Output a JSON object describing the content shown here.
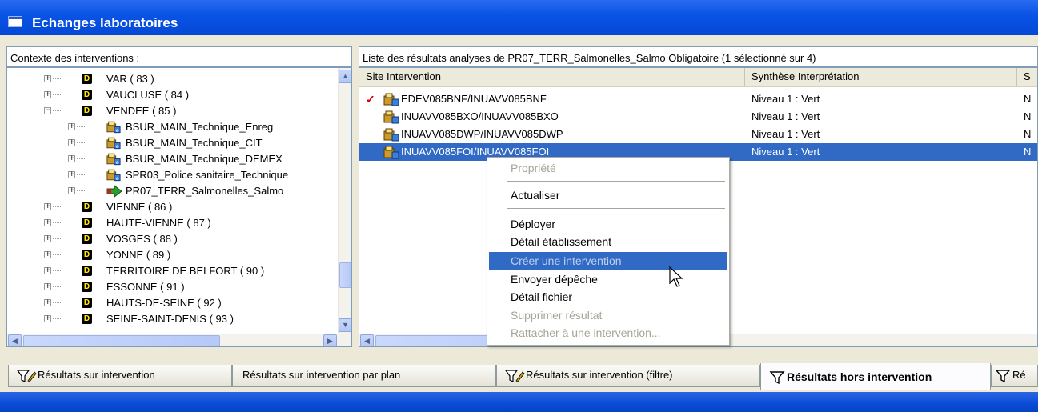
{
  "window": {
    "title": "Echanges laboratoires"
  },
  "left_pane": {
    "header": "Contexte des interventions :",
    "tree": [
      {
        "label": "VAR ( 83 )",
        "type": "dept",
        "expander": "+"
      },
      {
        "label": "VAUCLUSE ( 84 )",
        "type": "dept",
        "expander": "+"
      },
      {
        "label": "VENDEE ( 85 )",
        "type": "dept",
        "expander": "−"
      },
      {
        "label": "BSUR_MAIN_Technique_Enreg",
        "type": "folder",
        "expander": "+"
      },
      {
        "label": "BSUR_MAIN_Technique_CIT",
        "type": "folder",
        "expander": "+"
      },
      {
        "label": "BSUR_MAIN_Technique_DEMEX",
        "type": "folder",
        "expander": "+"
      },
      {
        "label": "SPR03_Police sanitaire_Technique",
        "type": "folder",
        "expander": "+"
      },
      {
        "label": "PR07_TERR_Salmonelles_Salmo",
        "type": "arrow",
        "expander": "+"
      },
      {
        "label": "VIENNE ( 86 )",
        "type": "dept",
        "expander": "+"
      },
      {
        "label": "HAUTE-VIENNE ( 87 )",
        "type": "dept",
        "expander": "+"
      },
      {
        "label": "VOSGES ( 88 )",
        "type": "dept",
        "expander": "+"
      },
      {
        "label": "YONNE ( 89 )",
        "type": "dept",
        "expander": "+"
      },
      {
        "label": "TERRITOIRE DE BELFORT ( 90 )",
        "type": "dept",
        "expander": "+"
      },
      {
        "label": "ESSONNE ( 91 )",
        "type": "dept",
        "expander": "+"
      },
      {
        "label": "HAUTS-DE-SEINE ( 92 )",
        "type": "dept",
        "expander": "+"
      },
      {
        "label": "SEINE-SAINT-DENIS ( 93 )",
        "type": "dept",
        "expander": "+"
      }
    ]
  },
  "right_pane": {
    "header": "Liste des résultats analyses de PR07_TERR_Salmonelles_Salmo Obligatoire (1 sélectionné sur 4)",
    "columns": [
      "Site Intervention",
      "Synthèse Interprétation",
      "S"
    ],
    "rows": [
      {
        "site": "EDEV085BNF/INUAVV085BNF",
        "synthese": "Niveau 1 : Vert",
        "col3": "N",
        "checked": "✓",
        "selected": false
      },
      {
        "site": "INUAVV085BXO/INUAVV085BXO",
        "synthese": "Niveau 1 : Vert",
        "col3": "N",
        "checked": "",
        "selected": false
      },
      {
        "site": "INUAVV085DWP/INUAVV085DWP",
        "synthese": "Niveau 1 : Vert",
        "col3": "N",
        "checked": "",
        "selected": false
      },
      {
        "site": "INUAVV085FOI/INUAVV085FOI",
        "synthese": "Niveau 1 : Vert",
        "col3": "N",
        "checked": "",
        "selected": true
      }
    ]
  },
  "context_menu": {
    "items": [
      {
        "label": "Propriété",
        "state": "disabled"
      },
      {
        "label": "Actualiser",
        "state": "enabled"
      },
      {
        "label": "Déployer",
        "state": "enabled"
      },
      {
        "label": "Détail établissement",
        "state": "enabled"
      },
      {
        "label": "Créer une intervention",
        "state": "highlighted"
      },
      {
        "label": "Envoyer dépêche",
        "state": "enabled"
      },
      {
        "label": "Détail fichier",
        "state": "enabled"
      },
      {
        "label": "Supprimer résultat",
        "state": "disabled"
      },
      {
        "label": "Rattacher à une intervention...",
        "state": "disabled"
      }
    ]
  },
  "tabs": [
    {
      "label": "Résultats sur intervention",
      "icon": "filter-pencil-icon",
      "active": false
    },
    {
      "label": "Résultats sur intervention par plan",
      "icon": "",
      "active": false
    },
    {
      "label": "Résultats sur intervention (filtre)",
      "icon": "filter-pencil-icon",
      "active": false
    },
    {
      "label": "Résultats hors intervention",
      "icon": "filter-icon",
      "active": true
    },
    {
      "label": "Ré",
      "icon": "filter-icon",
      "active": false
    }
  ],
  "colors": {
    "titlebar": "#0a54e6",
    "selection": "#316ac5",
    "check_mark": "#d40000",
    "dept_icon_text": "#ffeb00"
  },
  "scroll_icons": {
    "up": "▲",
    "down": "▼",
    "left": "◀",
    "right": "▶"
  }
}
